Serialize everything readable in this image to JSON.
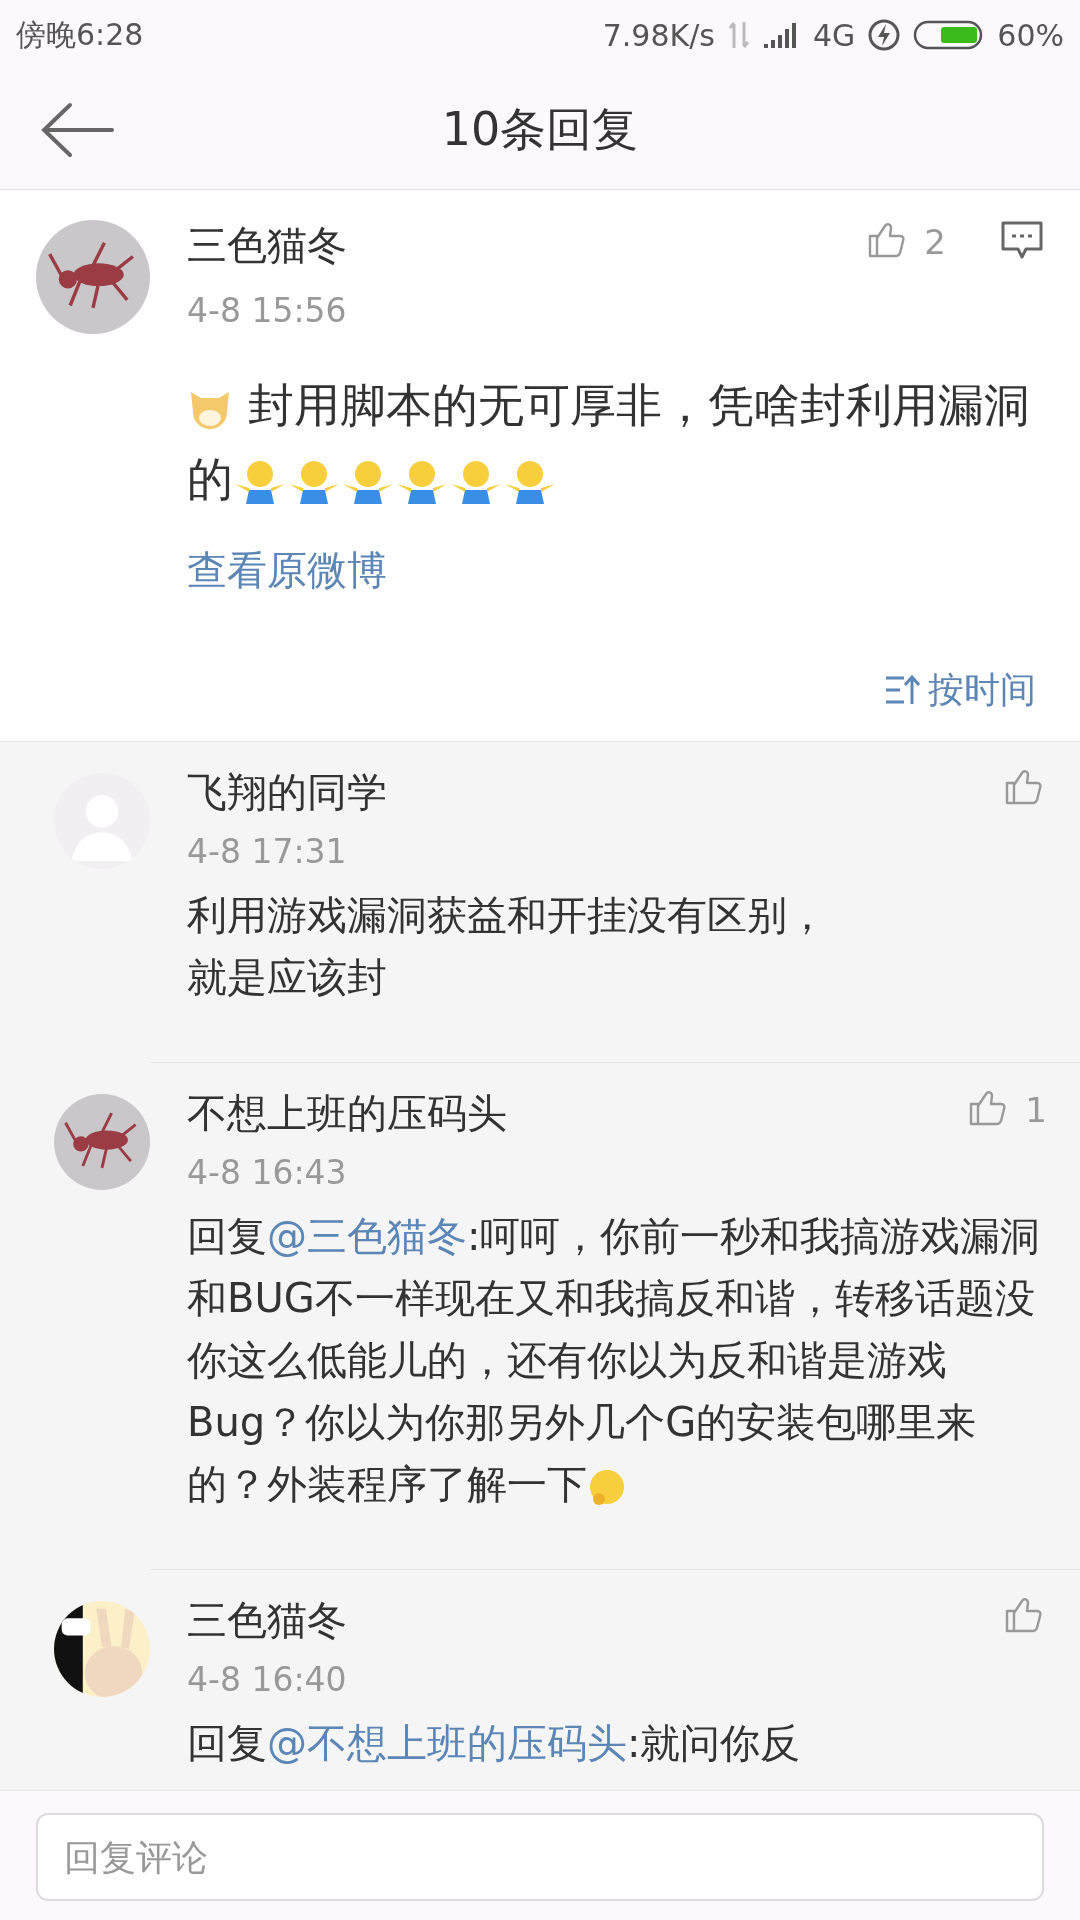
{
  "status_bar": {
    "time": "傍晚6:28",
    "speed": "7.98K/s",
    "network": "4G",
    "battery": "60%"
  },
  "header": {
    "title": "10条回复"
  },
  "post": {
    "author": "三色猫冬",
    "time": "4-8 15:56",
    "likes": "2",
    "content": [
      {
        "kind": "doge"
      },
      {
        "kind": "text",
        "text": " 封用脚本的无可厚非，凭啥封利用漏洞的"
      },
      {
        "kind": "shrug"
      },
      {
        "kind": "shrug"
      },
      {
        "kind": "shrug"
      },
      {
        "kind": "shrug"
      },
      {
        "kind": "shrug"
      },
      {
        "kind": "shrug"
      }
    ],
    "link": "查看原微博",
    "sort": "按时间"
  },
  "comments": [
    {
      "author": "飞翔的同学",
      "avatar": {
        "kind": "silhouette"
      },
      "time": "4-8 17:31",
      "content": [
        {
          "kind": "text",
          "text": "利用游戏漏洞获益和开挂没有区别，"
        },
        {
          "kind": "break"
        },
        {
          "kind": "text",
          "text": "就是应该封"
        }
      ]
    },
    {
      "author": "不想上班的压码头",
      "avatar": {
        "kind": "picture"
      },
      "time": "4-8 16:43",
      "likes": "1",
      "content": [
        {
          "kind": "text",
          "text": "回复"
        },
        {
          "kind": "mention",
          "text": "@三色猫冬"
        },
        {
          "kind": "text",
          "text": ":呵呵，你前一秒和我搞游戏漏洞和BUG不一样现在又和我搞反和谐，转移话题没你这么低能儿的，还有你以为反和谐是游戏Bug？你以为你那另外几个G的安装包哪里来的？外装程序了解一下"
        },
        {
          "kind": "thinking"
        }
      ]
    },
    {
      "author": "三色猫冬",
      "avatar": {
        "kind": "picture"
      },
      "time": "4-8 16:40",
      "content": [
        {
          "kind": "text",
          "text": "回复"
        },
        {
          "kind": "mention",
          "text": "@不想上班的压码头"
        },
        {
          "kind": "text",
          "text": ":就问你反"
        }
      ]
    }
  ],
  "reply_field": {
    "placeholder": "回复评论"
  }
}
